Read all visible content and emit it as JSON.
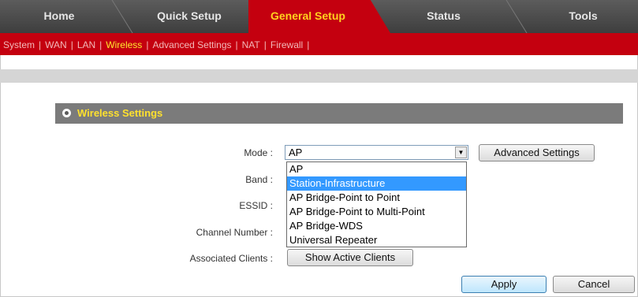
{
  "tabs": [
    {
      "label": "Home"
    },
    {
      "label": "Quick Setup"
    },
    {
      "label": "General Setup"
    },
    {
      "label": "Status"
    },
    {
      "label": "Tools"
    }
  ],
  "submenu": [
    "System",
    "WAN",
    "LAN",
    "Wireless",
    "Advanced Settings",
    "NAT",
    "Firewall"
  ],
  "section": {
    "title": "Wireless Settings"
  },
  "form": {
    "mode_label": "Mode :",
    "band_label": "Band :",
    "essid_label": "ESSID :",
    "channel_label": "Channel Number :",
    "clients_label": "Associated Clients :",
    "mode_value": "AP",
    "mode_options": [
      "AP",
      "Station-Infrastructure",
      "AP Bridge-Point to Point",
      "AP Bridge-Point to Multi-Point",
      "AP Bridge-WDS",
      "Universal Repeater"
    ],
    "advanced_button": "Advanced Settings",
    "clients_button": "Show Active Clients"
  },
  "actions": {
    "apply": "Apply",
    "cancel": "Cancel"
  },
  "colors": {
    "accent": "#c4000f",
    "highlight": "#ffe12e",
    "tabbar": "#4a4a4a"
  }
}
